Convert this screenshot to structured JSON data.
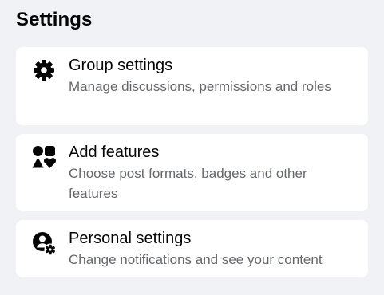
{
  "page": {
    "title": "Settings"
  },
  "items": [
    {
      "title": "Group settings",
      "description": "Manage discussions, permissions and roles",
      "icon": "gear-icon"
    },
    {
      "title": "Add features",
      "description": "Choose post formats, badges and other features",
      "icon": "shapes-icon"
    },
    {
      "title": "Personal settings",
      "description": "Change notifications and see your content",
      "icon": "person-gear-icon"
    }
  ]
}
